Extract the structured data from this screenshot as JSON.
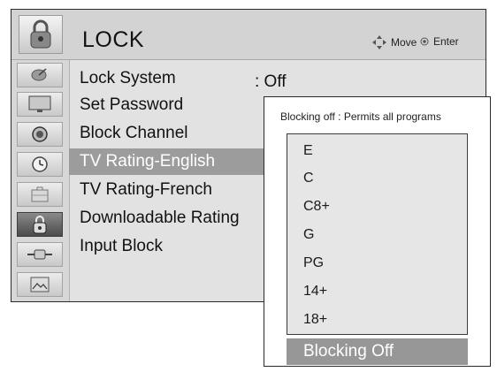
{
  "header": {
    "title": "LOCK",
    "move_label": "Move",
    "enter_label": "Enter"
  },
  "sidebar": {
    "icons": [
      "satellite-dish-icon",
      "monitor-icon",
      "speaker-icon",
      "clock-icon",
      "briefcase-icon",
      "lock-icon",
      "plug-icon",
      "picture-icon"
    ],
    "active_index": 5
  },
  "menu": {
    "items": [
      "Lock System",
      "Set Password",
      "Block Channel",
      "TV Rating-English",
      "TV Rating-French",
      "Downloadable Rating",
      "Input Block"
    ],
    "selected_index": 3,
    "lock_system_value": ": Off"
  },
  "submenu": {
    "description": "Blocking off : Permits all programs",
    "options": [
      "E",
      "C",
      "C8+",
      "G",
      "PG",
      "14+",
      "18+"
    ],
    "selected_option": "Blocking Off"
  }
}
